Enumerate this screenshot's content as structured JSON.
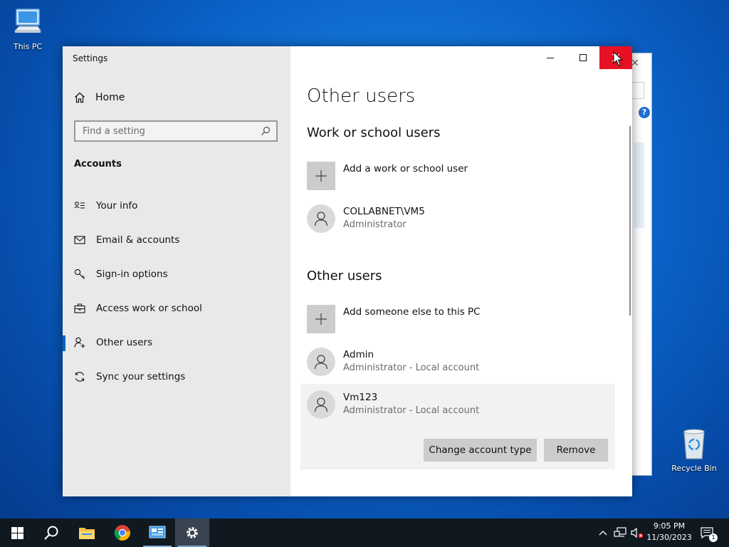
{
  "desktop": {
    "icons": [
      {
        "label": "This PC",
        "icon": "computer-icon"
      },
      {
        "label": "Recycle Bin",
        "icon": "recycle-bin-icon"
      }
    ]
  },
  "window": {
    "title": "Settings",
    "controls": {
      "minimize": "minimize-icon",
      "maximize": "maximize-icon",
      "close": "close-icon"
    }
  },
  "sidebar": {
    "home_label": "Home",
    "search_placeholder": "Find a setting",
    "category": "Accounts",
    "items": [
      {
        "label": "Your info",
        "icon": "person-card-icon",
        "active": false
      },
      {
        "label": "Email & accounts",
        "icon": "mail-icon",
        "active": false
      },
      {
        "label": "Sign-in options",
        "icon": "key-icon",
        "active": false
      },
      {
        "label": "Access work or school",
        "icon": "briefcase-icon",
        "active": false
      },
      {
        "label": "Other users",
        "icon": "person-add-icon",
        "active": true
      },
      {
        "label": "Sync your settings",
        "icon": "sync-icon",
        "active": false
      }
    ]
  },
  "main": {
    "title": "Other users",
    "work_section": {
      "heading": "Work or school users",
      "add_label": "Add a work or school user",
      "accounts": [
        {
          "name": "COLLABNET\\VM5",
          "role": "Administrator"
        }
      ]
    },
    "other_section": {
      "heading": "Other users",
      "add_label": "Add someone else to this PC",
      "accounts": [
        {
          "name": "Admin",
          "role": "Administrator - Local account"
        },
        {
          "name": "Vm123",
          "role": "Administrator - Local account"
        }
      ]
    },
    "buttons": {
      "change_account_type": "Change account type",
      "remove": "Remove"
    }
  },
  "taskbar": {
    "apps": [
      "start-icon",
      "search-icon",
      "file-explorer-icon",
      "chrome-icon",
      "control-panel-icon",
      "settings-gear-icon"
    ],
    "clock_time": "9:05 PM",
    "clock_date": "11/30/2023",
    "notification_count": "1"
  },
  "colors": {
    "accent": "#0067c0",
    "close_hover": "#e81123",
    "taskbar": "#101820"
  }
}
